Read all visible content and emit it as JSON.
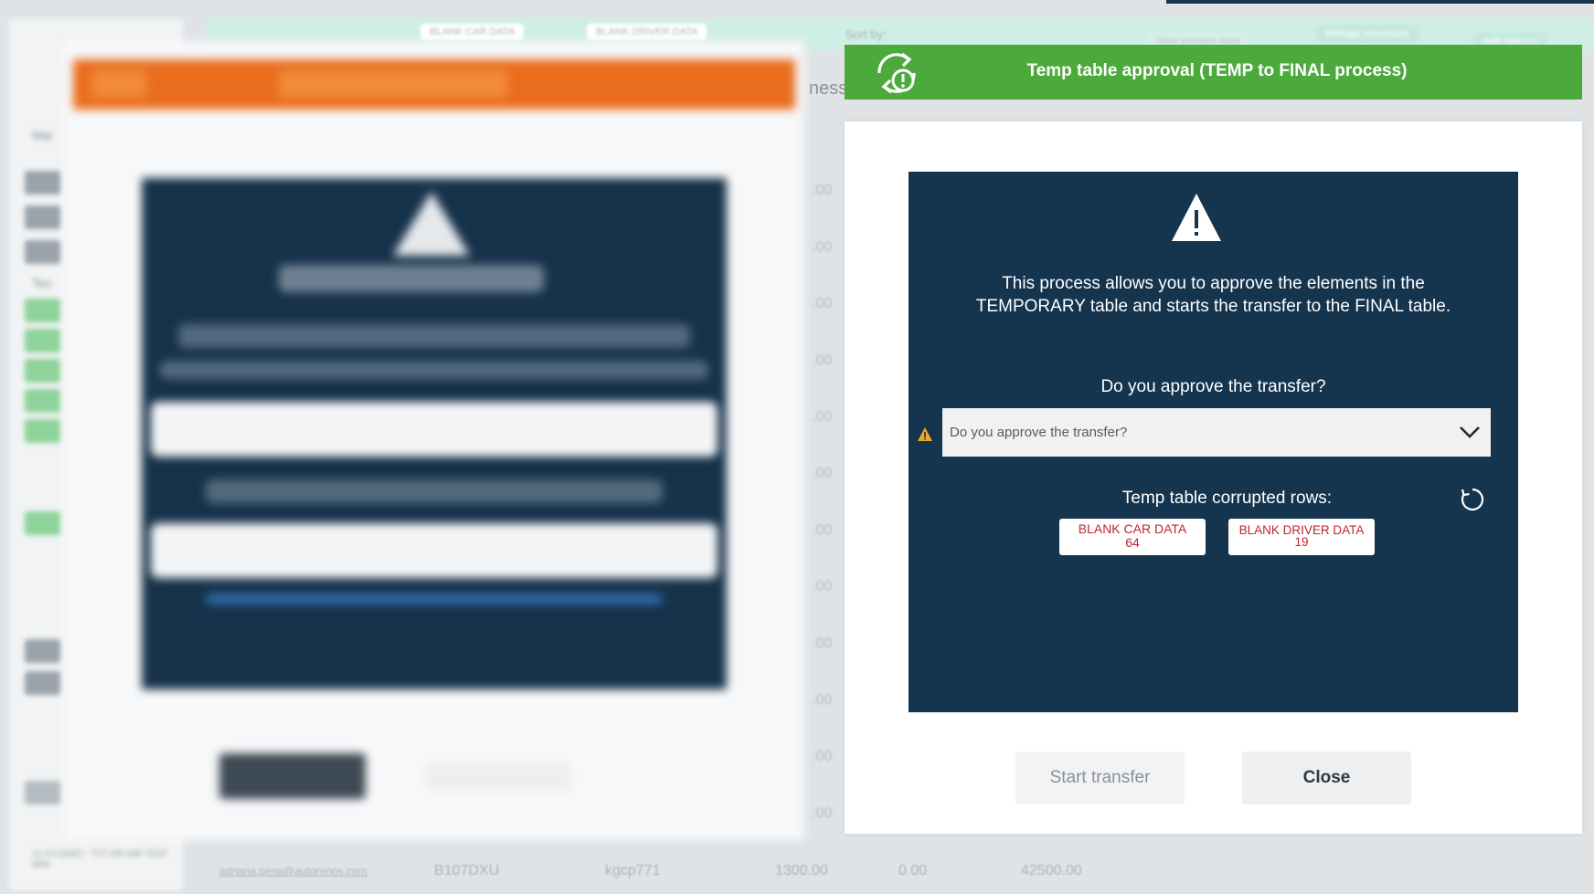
{
  "background": {
    "topbar_pills": [
      "BLANK CAR DATA",
      "BLANK DRIVER DATA"
    ],
    "sort_label": "Sort by:",
    "view_state_label": "View process state",
    "mileage_label": "Mileage processes",
    "add_new_label": "Add new (+)",
    "sidebar_titles": [
      "Mai",
      "Tec"
    ],
    "partial_header": "ness",
    "column_values": [
      ".00",
      ".00",
      ".00",
      ".00",
      ".00",
      ".00",
      ".00",
      ".00",
      ".00",
      ".00",
      ".00",
      ".00"
    ],
    "bottom_row": {
      "email": "adriana.pena@autorenos.com",
      "plate": "B107DXU",
      "code": "kgcp771",
      "amount1": "1300.00",
      "amount2": "0.00",
      "amount3": "42500.00"
    },
    "version_text": "v1.2.0 (DAT) - TVT KR with TEST data"
  },
  "modal": {
    "title": "Temp table approval (TEMP to FINAL process)",
    "header_icon": "refresh-warning-icon",
    "header_color": "#4caa3c",
    "panel_color": "#15344e",
    "description_line1": "This process allows you to approve the elements in the",
    "description_line2": "TEMPORARY table and starts the transfer to the FINAL table.",
    "question_label": "Do you approve the transfer?",
    "select": {
      "placeholder": "Do you approve the transfer?"
    },
    "corrupted_label": "Temp table corrupted rows:",
    "badges": [
      {
        "label": "BLANK CAR DATA",
        "count": "64"
      },
      {
        "label": "BLANK DRIVER DATA",
        "count": "19"
      }
    ],
    "badge_text_color": "#c0252b",
    "buttons": {
      "start": "Start transfer",
      "close": "Close"
    }
  }
}
